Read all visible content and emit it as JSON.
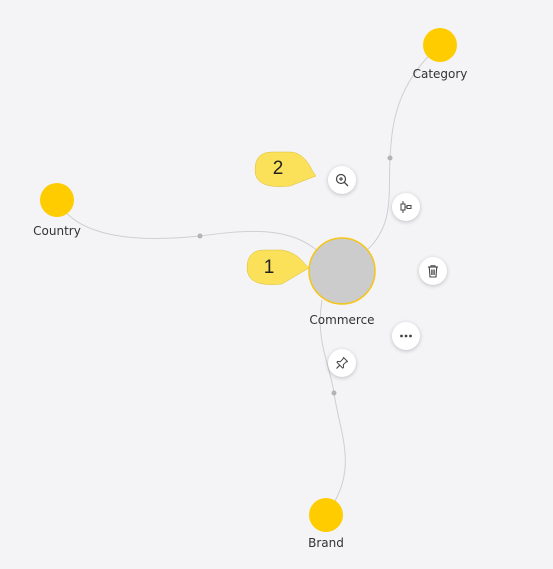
{
  "graph": {
    "center": {
      "label": "Commerce"
    },
    "nodes": [
      {
        "id": "category",
        "label": "Category"
      },
      {
        "id": "country",
        "label": "Country"
      },
      {
        "id": "brand",
        "label": "Brand"
      }
    ]
  },
  "toolbar": {
    "zoom_icon": "zoom-in-icon",
    "expand_icon": "expand-icon",
    "delete_icon": "trash-icon",
    "more_icon": "more-horizontal-icon",
    "pin_icon": "pin-icon"
  },
  "callouts": [
    {
      "number": "1"
    },
    {
      "number": "2"
    }
  ],
  "colors": {
    "node": "#ffcc00",
    "center_fill": "#cccccc",
    "center_stroke": "#f5c518",
    "edge": "#cfcfcf",
    "callout": "#fbe05a"
  }
}
